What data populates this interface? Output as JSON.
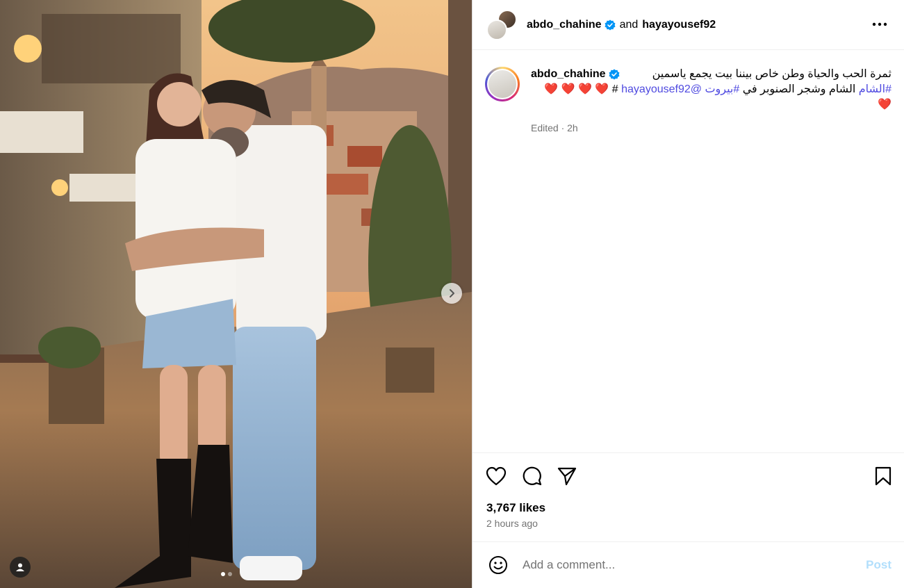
{
  "post": {
    "header": {
      "author": "abdo_chahine",
      "joiner": "and",
      "collaborator": "hayayousef92",
      "verified_icon": "verified-badge-icon",
      "more_icon": "more-options-icon"
    },
    "caption": {
      "username": "abdo_chahine",
      "text_line1": "ثمرة الحب والحياة وطن خاص بيننا بيت يجمع ياسمين",
      "text_line2_pre": "الشام وشجر الصنوبر في ",
      "hashtag_sham": "#الشام",
      "hashtag_beirut": "#بيروت",
      "mention": "@hayayousef92",
      "hash_suffix": "#",
      "hearts": "❤️ ❤️ ❤️ ❤️ ❤️",
      "edited": "Edited · 2h"
    },
    "likes": "3,767 likes",
    "time_ago": "2 hours ago",
    "comment": {
      "placeholder": "Add a comment...",
      "post_label": "Post"
    },
    "carousel": {
      "total": 2,
      "active": 1
    },
    "colors": {
      "link": "#4f4ae0",
      "verified": "#0095f6",
      "post_disabled": "#b2dffc",
      "heart": "#ed2b6f"
    }
  }
}
